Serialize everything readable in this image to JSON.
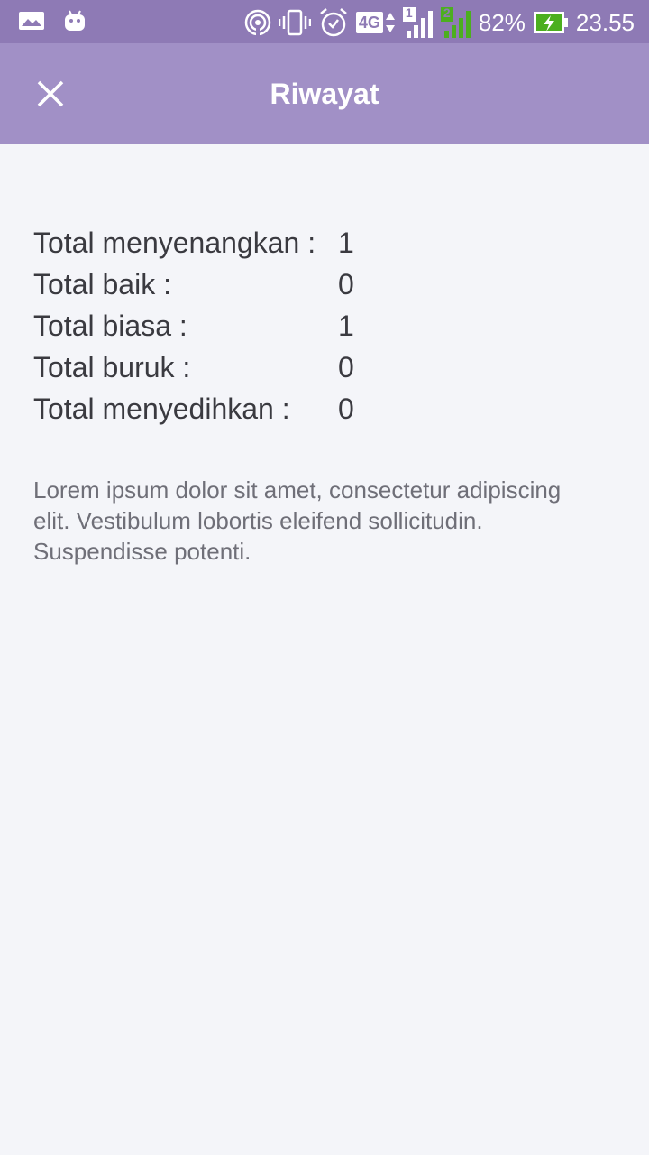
{
  "status_bar": {
    "battery_percent": "82%",
    "time": "23.55",
    "network_type": "4G",
    "sim1_label": "1",
    "sim2_label": "2",
    "icons": [
      "image-icon",
      "android-icon",
      "hotspot-icon",
      "vibrate-icon",
      "alarm-icon",
      "network-4g-icon",
      "signal-sim1-icon",
      "signal-sim2-icon",
      "battery-charging-icon"
    ],
    "colors": {
      "background": "#8e7ab5",
      "sim2_signal": "#4caf1f",
      "battery": "#4caf1f"
    }
  },
  "app_bar": {
    "title": "Riwayat",
    "close_icon": "close-icon",
    "background": "#a190c6"
  },
  "stats": [
    {
      "label": "Total menyenangkan :",
      "value": "1"
    },
    {
      "label": "Total baik :",
      "value": "0"
    },
    {
      "label": "Total biasa :",
      "value": "1"
    },
    {
      "label": "Total buruk :",
      "value": "0"
    },
    {
      "label": "Total menyedihkan :",
      "value": "0"
    }
  ],
  "description": "Lorem ipsum dolor sit amet, consectetur adipiscing elit. Vestibulum lobortis eleifend sollicitudin. Suspendisse potenti."
}
